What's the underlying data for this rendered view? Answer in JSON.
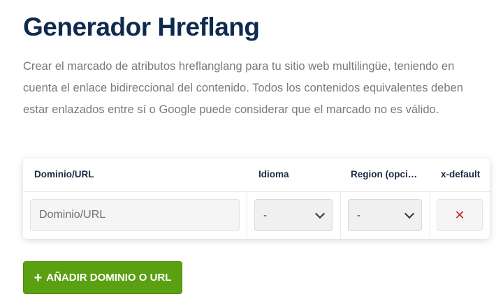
{
  "page": {
    "title": "Generador Hreflang",
    "description": "Crear el marcado de atributos hreflanglang para tu sitio web multilingüe, teniendo en cuenta el enlace bidireccional del contenido. Todos los contenidos equivalentes deben estar enlazados entre sí o Google puede considerar que el marcado no es válido."
  },
  "table": {
    "headers": {
      "url": "Dominio/URL",
      "language": "Idioma",
      "region": "Region (opcional)",
      "xdefault": "x-default"
    },
    "row": {
      "url_placeholder": "Dominio/URL",
      "language_value": "-",
      "region_value": "-",
      "remove_symbol": "✕"
    }
  },
  "actions": {
    "add_icon": "+",
    "add_label": "AÑADIR DOMINIO O URL"
  },
  "colors": {
    "title": "#0f2a4f",
    "text": "#7a7a7a",
    "add_button": "#5aa012",
    "remove": "#c62828"
  },
  "icons": {
    "remove": "close-icon",
    "add": "plus-icon",
    "select": "chevron-down-icon"
  }
}
